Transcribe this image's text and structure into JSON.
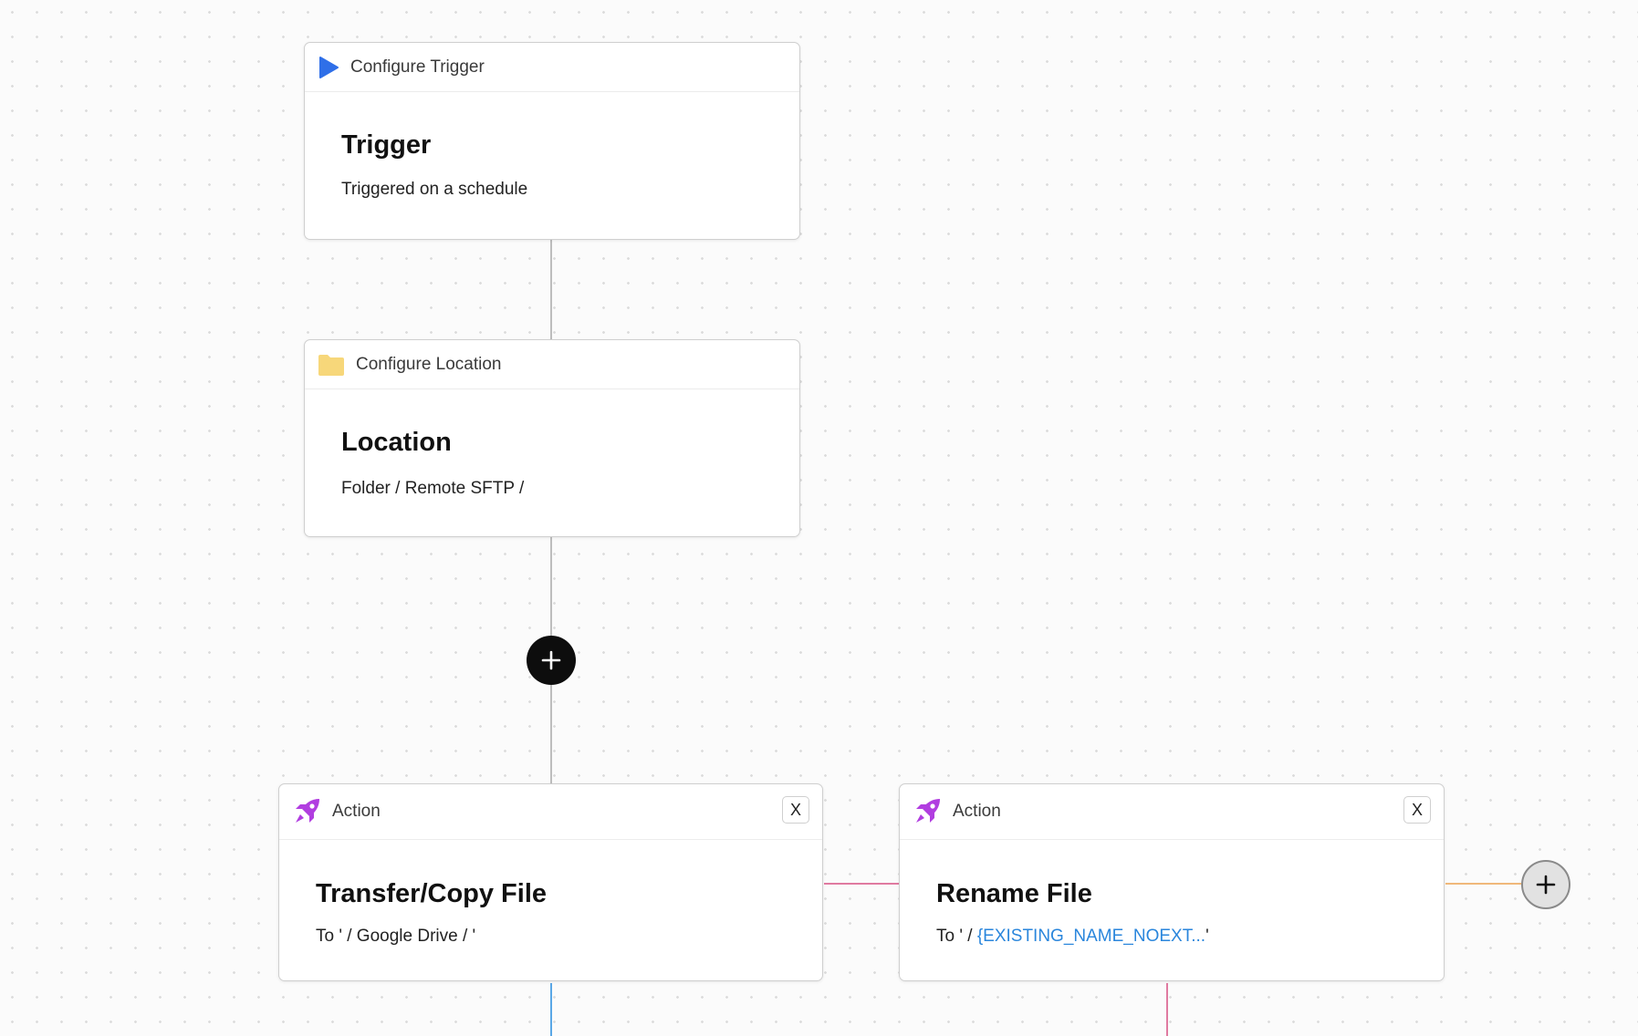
{
  "colors": {
    "trigger_icon": "#2f6fe8",
    "folder_icon": "#f7d77a",
    "rocket_icon": "#b13de0",
    "connector_gray": "#bdbdbd",
    "connector_pink": "#e07aa0",
    "connector_orange": "#f0b87a",
    "connector_blue": "#5aa7e6",
    "variable_text": "#2a86dc"
  },
  "trigger_card": {
    "header_icon": "play-icon",
    "header_label": "Configure Trigger",
    "title": "Trigger",
    "subtitle": "Triggered on a schedule"
  },
  "location_card": {
    "header_icon": "folder-icon",
    "header_label": "Configure Location",
    "title": "Location",
    "subtitle": "Folder / Remote SFTP /"
  },
  "add_step_button": {
    "icon": "plus-icon"
  },
  "action_cards": [
    {
      "header_icon": "rocket-icon",
      "header_label": "Action",
      "close_label": "X",
      "title": "Transfer/Copy File",
      "subtitle_prefix": "To ' / Google Drive / '",
      "subtitle_variable": "",
      "subtitle_suffix": ""
    },
    {
      "header_icon": "rocket-icon",
      "header_label": "Action",
      "close_label": "X",
      "title": "Rename File",
      "subtitle_prefix": "To ' / ",
      "subtitle_variable": "{EXISTING_NAME_NOEXT...",
      "subtitle_suffix": "'"
    }
  ],
  "add_action_button": {
    "icon": "plus-icon"
  }
}
